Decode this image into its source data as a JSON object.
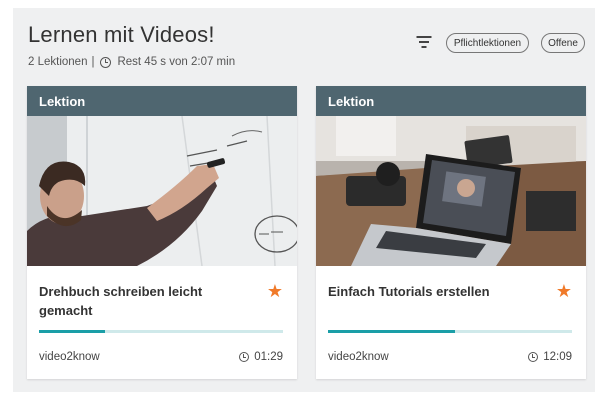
{
  "header": {
    "title": "Lernen mit Videos!",
    "lesson_count": "2 Lektionen",
    "separator": "|",
    "remaining": "Rest 45 s von 2:07 min",
    "filter_required": "Pflichtlektionen",
    "filter_open": "Offene"
  },
  "cards": [
    {
      "label": "Lektion",
      "title": "Drehbuch schreiben leicht gemacht",
      "author": "video2know",
      "duration": "01:29",
      "progress": 0.27,
      "favorite": "★"
    },
    {
      "label": "Lektion",
      "title": "Einfach Tutorials erstellen",
      "author": "video2know",
      "duration": "12:09",
      "progress": 0.52,
      "favorite": "★"
    }
  ],
  "colors": {
    "header_bar": "#4f6670",
    "progress_fill": "#1a9ea7",
    "progress_track": "#cfe9ea",
    "star": "#f07a2a"
  }
}
